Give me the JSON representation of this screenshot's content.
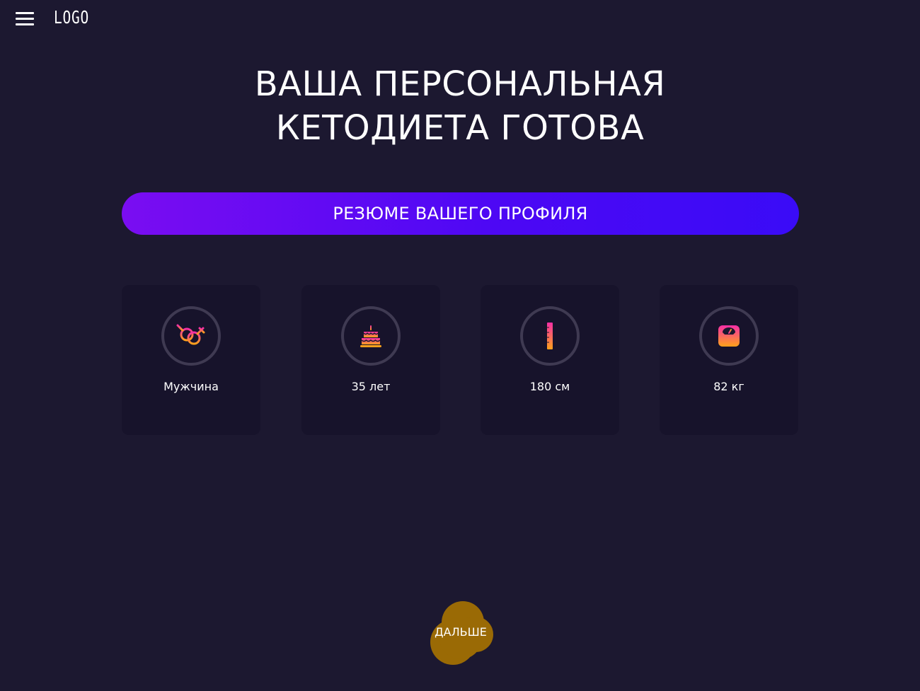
{
  "header": {
    "logo_text": "LOGO",
    "menu_icon": "hamburger-menu-icon"
  },
  "title": {
    "line1": "ВАША ПЕРСОНАЛЬНАЯ",
    "line2": "КЕТОДИЕТА ГОТОВА"
  },
  "summary": {
    "label": "РЕЗЮМЕ ВАШЕГО ПРОФИЛЯ",
    "gradient_start": "#7a0df2",
    "gradient_end": "#3a0bf7"
  },
  "cards": [
    {
      "icon": "gender-icon",
      "label": "Мужчина"
    },
    {
      "icon": "birthday-cake-icon",
      "label": "35 лет"
    },
    {
      "icon": "height-ruler-icon",
      "label": "180 см"
    },
    {
      "icon": "weight-scale-icon",
      "label": "82 кг"
    }
  ],
  "next_button": {
    "label": "ДАЛЬШЕ",
    "color": "#9a6a05"
  },
  "colors": {
    "background": "#1c1830",
    "card": "#17132b",
    "icon_gradient_top": "#f62ea6",
    "icon_gradient_bottom": "#ffa21a"
  }
}
